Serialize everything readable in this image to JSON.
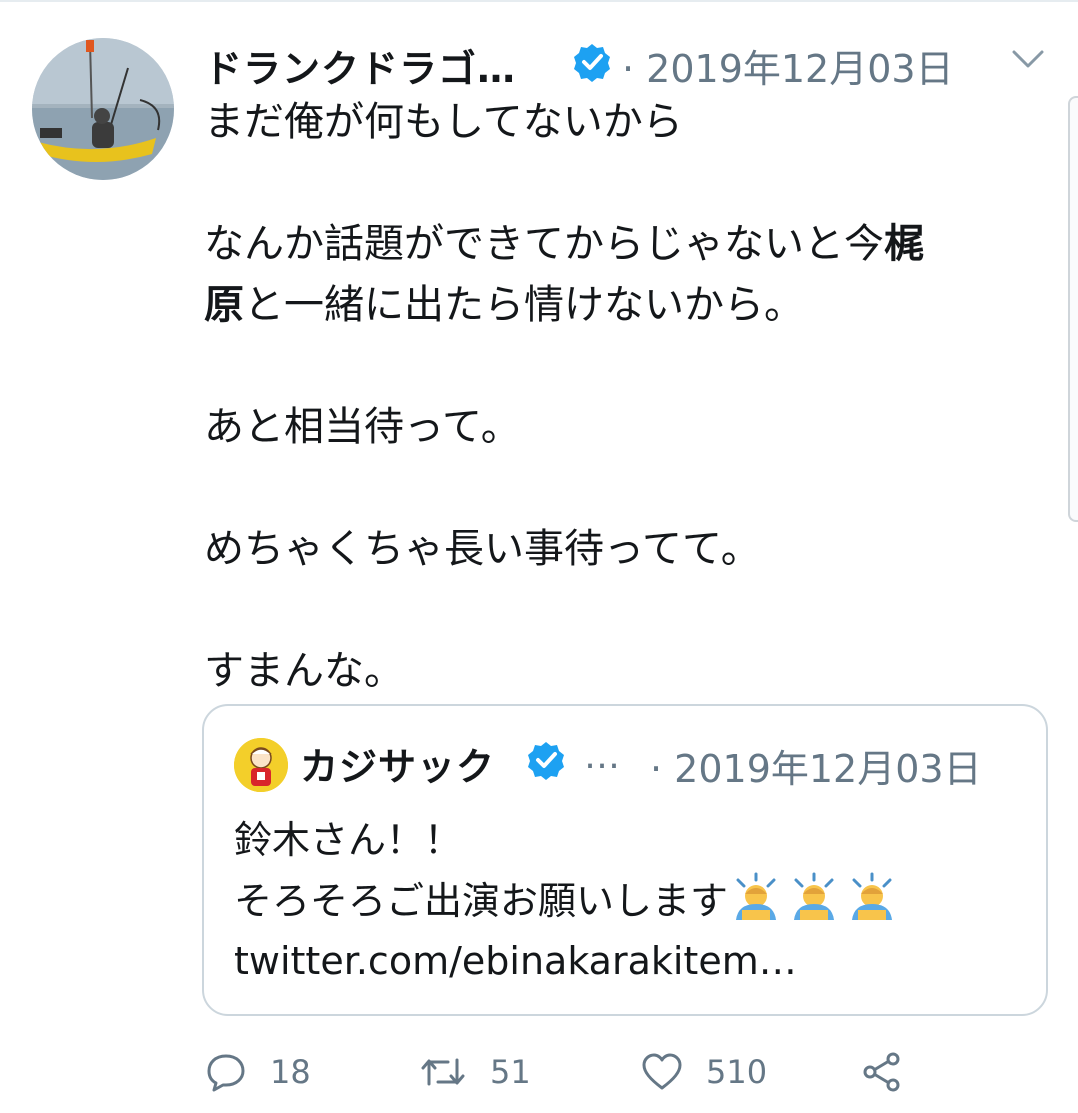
{
  "tweet": {
    "author_name": "ドランクドラゴ…",
    "meta": "· 2019年12月03日",
    "text_lines": [
      "まだ俺が何もしてないから",
      "",
      "なんか話題ができてからじゃないと今",
      "",
      "あと相当待って。",
      "",
      "めちゃくちゃ長い事待ってて。",
      "",
      "すまんな。"
    ],
    "line3_bold": "梶",
    "line4_bold": "原",
    "line4_rest": "と一緒に出たら情けないから。"
  },
  "quote": {
    "author_name": "カジサック",
    "ellipsis": "…",
    "meta": "· 2019年12月03日",
    "line1": "鈴木さん！！",
    "line2": "そろそろご出演お願いします",
    "emoji_name": "person-bowing-emoji",
    "link": "twitter.com/ebinakarakitem…"
  },
  "actions": {
    "reply_count": "18",
    "retweet_count": "51",
    "like_count": "510"
  },
  "colors": {
    "verified": "#1da1f2",
    "muted": "#657786",
    "border": "#ccd6dd"
  }
}
